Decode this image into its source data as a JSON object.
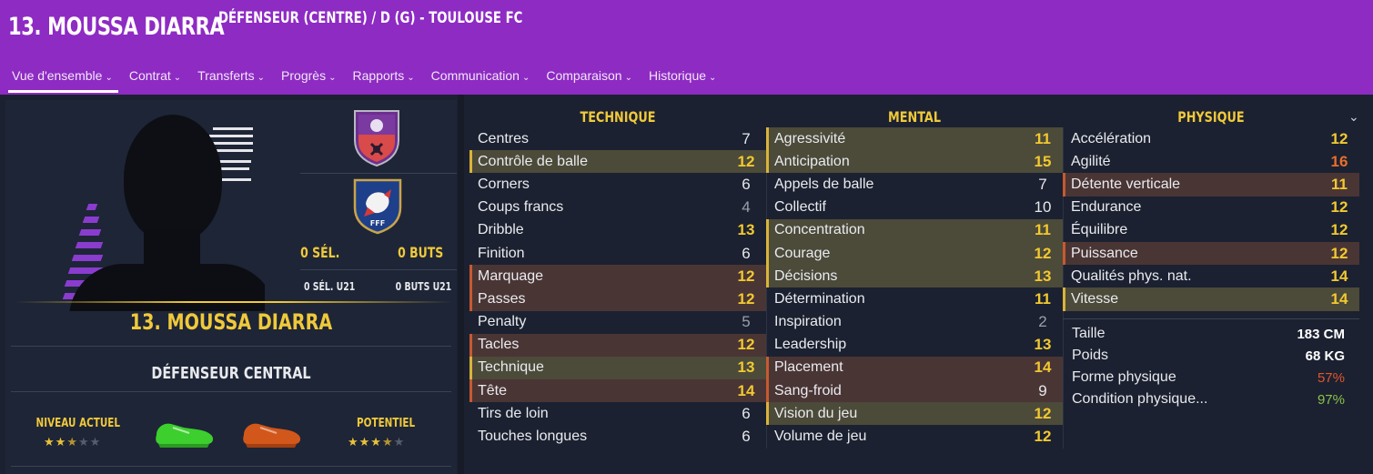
{
  "header": {
    "player_title": "13. MOUSSA DIARRA",
    "subtitle": "DÉFENSEUR (CENTRE) / D (G) - TOULOUSE FC",
    "tabs": [
      {
        "label": "Vue d'ensemble",
        "active": true
      },
      {
        "label": "Contrat"
      },
      {
        "label": "Transferts"
      },
      {
        "label": "Progrès"
      },
      {
        "label": "Rapports"
      },
      {
        "label": "Communication"
      },
      {
        "label": "Comparaison"
      },
      {
        "label": "Historique"
      }
    ],
    "tab_chevron": "⌄",
    "accent_color": "#8e2bc3"
  },
  "profile": {
    "name": "13. MOUSSA DIARRA",
    "position": "DÉFENSEUR CENTRAL",
    "caps": "0 SÉL.",
    "goals": "0 BUTS",
    "caps_u21": "0 SÉL. U21",
    "goals_u21": "0 BUTS U21",
    "current_ability_label": "NIVEAU ACTUEL",
    "potential_label": "POTENTIEL",
    "current_ability_stars": 2.5,
    "potential_stars": 3.5,
    "badge_club_icon": "toulouse-fc-crest-icon",
    "badge_nation_icon": "fff-france-crest-icon",
    "left_foot_icon": "green-boot-icon",
    "right_foot_icon": "orange-boot-icon"
  },
  "attributes": {
    "technique": {
      "title": "TECHNIQUE",
      "items": [
        {
          "label": "Centres",
          "value": "7",
          "style": "white",
          "hl": ""
        },
        {
          "label": "Contrôle de balle",
          "value": "12",
          "style": "yellow",
          "hl": "y"
        },
        {
          "label": "Corners",
          "value": "6",
          "style": "white",
          "hl": ""
        },
        {
          "label": "Coups francs",
          "value": "4",
          "style": "grey",
          "hl": ""
        },
        {
          "label": "Dribble",
          "value": "13",
          "style": "yellow",
          "hl": ""
        },
        {
          "label": "Finition",
          "value": "6",
          "style": "white",
          "hl": ""
        },
        {
          "label": "Marquage",
          "value": "12",
          "style": "yellow",
          "hl": "r"
        },
        {
          "label": "Passes",
          "value": "12",
          "style": "yellow",
          "hl": "r"
        },
        {
          "label": "Penalty",
          "value": "5",
          "style": "grey",
          "hl": ""
        },
        {
          "label": "Tacles",
          "value": "12",
          "style": "yellow",
          "hl": "r"
        },
        {
          "label": "Technique",
          "value": "13",
          "style": "yellow",
          "hl": "y"
        },
        {
          "label": "Tête",
          "value": "14",
          "style": "yellow",
          "hl": "r"
        },
        {
          "label": "Tirs de loin",
          "value": "6",
          "style": "white",
          "hl": ""
        },
        {
          "label": "Touches longues",
          "value": "6",
          "style": "white",
          "hl": ""
        }
      ]
    },
    "mental": {
      "title": "MENTAL",
      "items": [
        {
          "label": "Agressivité",
          "value": "11",
          "style": "yellow",
          "hl": "y"
        },
        {
          "label": "Anticipation",
          "value": "15",
          "style": "yellow",
          "hl": "y"
        },
        {
          "label": "Appels de balle",
          "value": "7",
          "style": "white",
          "hl": ""
        },
        {
          "label": "Collectif",
          "value": "10",
          "style": "white",
          "hl": ""
        },
        {
          "label": "Concentration",
          "value": "11",
          "style": "yellow",
          "hl": "y"
        },
        {
          "label": "Courage",
          "value": "12",
          "style": "yellow",
          "hl": "y"
        },
        {
          "label": "Décisions",
          "value": "13",
          "style": "yellow",
          "hl": "y"
        },
        {
          "label": "Détermination",
          "value": "11",
          "style": "yellow",
          "hl": ""
        },
        {
          "label": "Inspiration",
          "value": "2",
          "style": "grey",
          "hl": ""
        },
        {
          "label": "Leadership",
          "value": "13",
          "style": "yellow",
          "hl": ""
        },
        {
          "label": "Placement",
          "value": "14",
          "style": "yellow",
          "hl": "r"
        },
        {
          "label": "Sang-froid",
          "value": "9",
          "style": "white",
          "hl": "r"
        },
        {
          "label": "Vision du jeu",
          "value": "12",
          "style": "yellow",
          "hl": "y"
        },
        {
          "label": "Volume de jeu",
          "value": "12",
          "style": "yellow",
          "hl": ""
        }
      ]
    },
    "physique": {
      "title": "PHYSIQUE",
      "items": [
        {
          "label": "Accélération",
          "value": "12",
          "style": "yellow",
          "hl": ""
        },
        {
          "label": "Agilité",
          "value": "16",
          "style": "orange",
          "hl": ""
        },
        {
          "label": "Détente verticale",
          "value": "11",
          "style": "yellow",
          "hl": "r"
        },
        {
          "label": "Endurance",
          "value": "12",
          "style": "yellow",
          "hl": ""
        },
        {
          "label": "Équilibre",
          "value": "12",
          "style": "yellow",
          "hl": ""
        },
        {
          "label": "Puissance",
          "value": "12",
          "style": "yellow",
          "hl": "r"
        },
        {
          "label": "Qualités phys. nat.",
          "value": "14",
          "style": "yellow",
          "hl": ""
        },
        {
          "label": "Vitesse",
          "value": "14",
          "style": "yellow",
          "hl": "y"
        }
      ]
    }
  },
  "physical_info": [
    {
      "label": "Taille",
      "value": "183 CM",
      "style": "bold"
    },
    {
      "label": "Poids",
      "value": "68 KG",
      "style": "bold"
    },
    {
      "label": "Forme physique",
      "value": "57%",
      "style": "red"
    },
    {
      "label": "Condition physique...",
      "value": "97%",
      "style": "green"
    }
  ]
}
